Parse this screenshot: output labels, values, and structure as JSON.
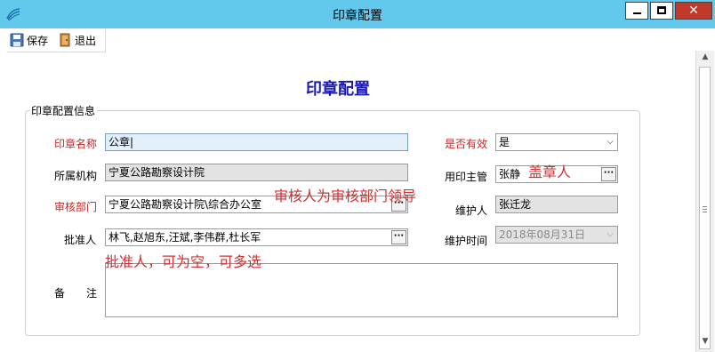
{
  "window": {
    "title": "印章配置",
    "close_glyph": "✕"
  },
  "toolbar": {
    "save_label": "保存",
    "exit_label": "退出"
  },
  "page": {
    "title": "印章配置"
  },
  "group": {
    "legend": "印章配置信息"
  },
  "form": {
    "seal_name": {
      "label": "印章名称",
      "value": "公章|"
    },
    "valid": {
      "label": "是否有效",
      "value": "是"
    },
    "org": {
      "label": "所属机构",
      "value": "宁夏公路勘察设计院"
    },
    "seal_user": {
      "label": "用印主管",
      "value": "张静"
    },
    "review_dept": {
      "label": "审核部门",
      "value": "宁夏公路勘察设计院\\综合办公室"
    },
    "maintainer": {
      "label": "维护人",
      "value": "张迁龙"
    },
    "approver": {
      "label": "批准人",
      "value": "林飞,赵旭东,汪斌,李伟群,杜长军"
    },
    "maintain_time": {
      "label": "维护时间",
      "value": "2018年08月31日"
    },
    "remark": {
      "label": "备　　注"
    }
  },
  "annotations": {
    "seal_user_note": "盖章人",
    "reviewer_note": "审核人为审核部门领导",
    "approver_note": "批准人，可为空，可多选"
  },
  "colors": {
    "titlebar": "#62c8ec",
    "required_label": "#cc2222",
    "page_title": "#1a1ab3",
    "annotation": "#d03030"
  }
}
